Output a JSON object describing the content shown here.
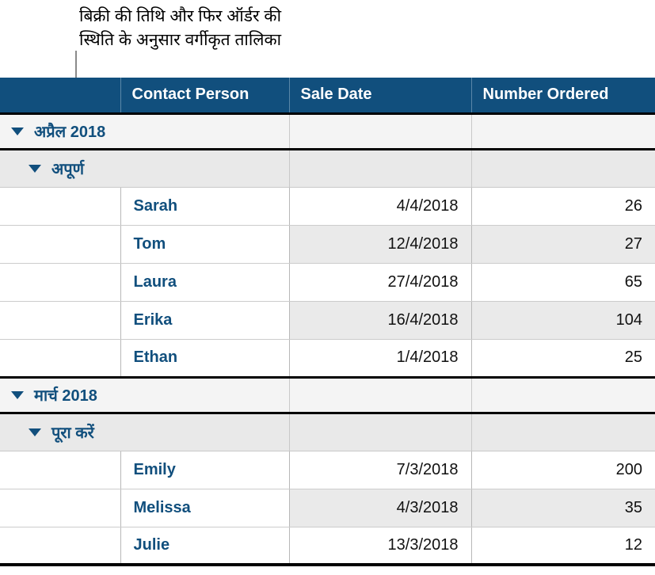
{
  "annotation": {
    "text": "बिक्री की तिथि और फिर ऑर्डर की\nस्थिति के अनुसार वर्गीकृत तालिका"
  },
  "colors": {
    "header_blue": "#114f7d",
    "accent_text": "#114f7d",
    "row_shade": "#eaeaea",
    "group_shade": "#f4f4f4",
    "subgroup_shade": "#e9e9e9"
  },
  "table": {
    "columns": [
      {
        "key": "handle",
        "label": ""
      },
      {
        "key": "name",
        "label": "Contact Person"
      },
      {
        "key": "date",
        "label": "Sale Date"
      },
      {
        "key": "num",
        "label": "Number Ordered"
      }
    ],
    "groups": [
      {
        "label": "अप्रैल 2018",
        "disclosure": "triangle-down-icon",
        "subgroups": [
          {
            "label": "अपूर्ण",
            "disclosure": "triangle-down-icon",
            "rows": [
              {
                "name": "Sarah",
                "date": "4/4/2018",
                "num": "26"
              },
              {
                "name": "Tom",
                "date": "12/4/2018",
                "num": "27"
              },
              {
                "name": "Laura",
                "date": "27/4/2018",
                "num": "65"
              },
              {
                "name": "Erika",
                "date": "16/4/2018",
                "num": "104"
              },
              {
                "name": "Ethan",
                "date": "1/4/2018",
                "num": "25"
              }
            ]
          }
        ]
      },
      {
        "label": "मार्च 2018",
        "disclosure": "triangle-down-icon",
        "subgroups": [
          {
            "label": "पूरा करें",
            "disclosure": "triangle-down-icon",
            "rows": [
              {
                "name": "Emily",
                "date": "7/3/2018",
                "num": "200"
              },
              {
                "name": "Melissa",
                "date": "4/3/2018",
                "num": "35"
              },
              {
                "name": "Julie",
                "date": "13/3/2018",
                "num": "12"
              }
            ]
          }
        ]
      }
    ]
  }
}
